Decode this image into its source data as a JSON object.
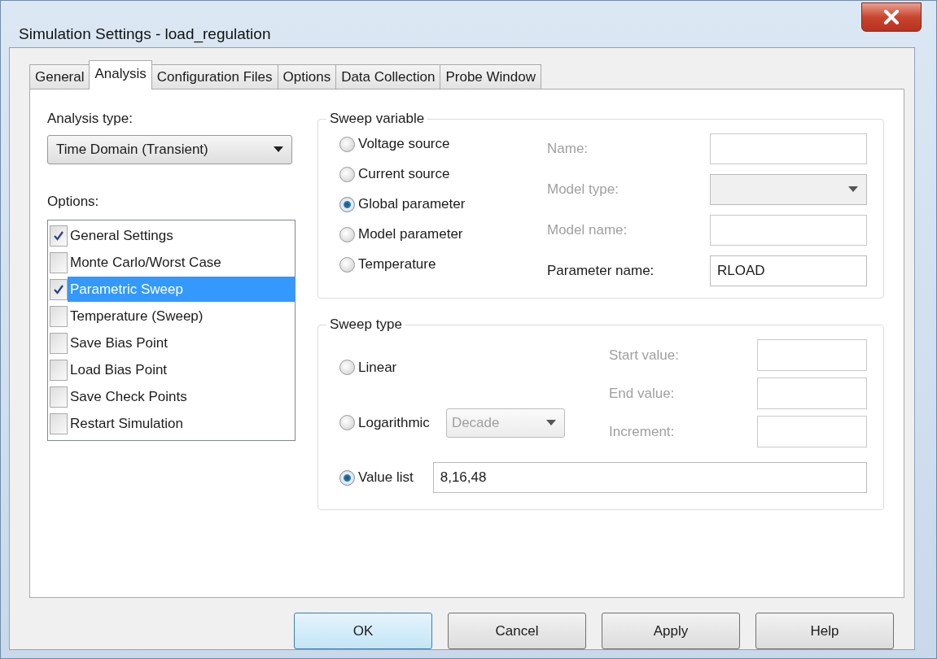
{
  "window": {
    "title": "Simulation Settings - load_regulation"
  },
  "tabs": [
    {
      "label": "General",
      "selected": false
    },
    {
      "label": "Analysis",
      "selected": true
    },
    {
      "label": "Configuration Files",
      "selected": false
    },
    {
      "label": "Options",
      "selected": false
    },
    {
      "label": "Data Collection",
      "selected": false
    },
    {
      "label": "Probe Window",
      "selected": false
    }
  ],
  "analysis_type": {
    "label": "Analysis type:",
    "value": "Time Domain (Transient)"
  },
  "options": {
    "label": "Options:",
    "items": [
      {
        "label": "General Settings",
        "checked": true,
        "selected": false
      },
      {
        "label": "Monte Carlo/Worst Case",
        "checked": false,
        "selected": false
      },
      {
        "label": "Parametric Sweep",
        "checked": true,
        "selected": true
      },
      {
        "label": "Temperature (Sweep)",
        "checked": false,
        "selected": false
      },
      {
        "label": "Save Bias Point",
        "checked": false,
        "selected": false
      },
      {
        "label": "Load Bias Point",
        "checked": false,
        "selected": false
      },
      {
        "label": "Save Check Points",
        "checked": false,
        "selected": false
      },
      {
        "label": "Restart Simulation",
        "checked": false,
        "selected": false
      }
    ]
  },
  "sweep_variable": {
    "title": "Sweep variable",
    "choices": [
      {
        "label": "Voltage source",
        "selected": false
      },
      {
        "label": "Current source",
        "selected": false
      },
      {
        "label": "Global parameter",
        "selected": true
      },
      {
        "label": "Model parameter",
        "selected": false
      },
      {
        "label": "Temperature",
        "selected": false
      }
    ],
    "fields": [
      {
        "label": "Name:",
        "kind": "text",
        "disabled": true
      },
      {
        "label": "Model type:",
        "kind": "dropdown",
        "disabled": true
      },
      {
        "label": "Model name:",
        "kind": "text",
        "disabled": true
      },
      {
        "label": "Parameter name:",
        "kind": "text",
        "disabled": false,
        "value": "RLOAD"
      }
    ]
  },
  "sweep_type": {
    "title": "Sweep type",
    "choices": [
      {
        "label": "Linear",
        "selected": false
      },
      {
        "label": "Logarithmic",
        "selected": false,
        "scale": {
          "value": "Decade",
          "disabled": true
        }
      },
      {
        "label": "Value list",
        "selected": true,
        "value": "8,16,48"
      }
    ],
    "fields": [
      {
        "label": "Start value:",
        "disabled": true
      },
      {
        "label": "End value:",
        "disabled": true
      },
      {
        "label": "Increment:",
        "disabled": true
      }
    ]
  },
  "buttons": [
    {
      "label": "OK",
      "default": true
    },
    {
      "label": "Cancel",
      "default": false
    },
    {
      "label": "Apply",
      "default": false
    },
    {
      "label": "Help",
      "default": false
    }
  ]
}
